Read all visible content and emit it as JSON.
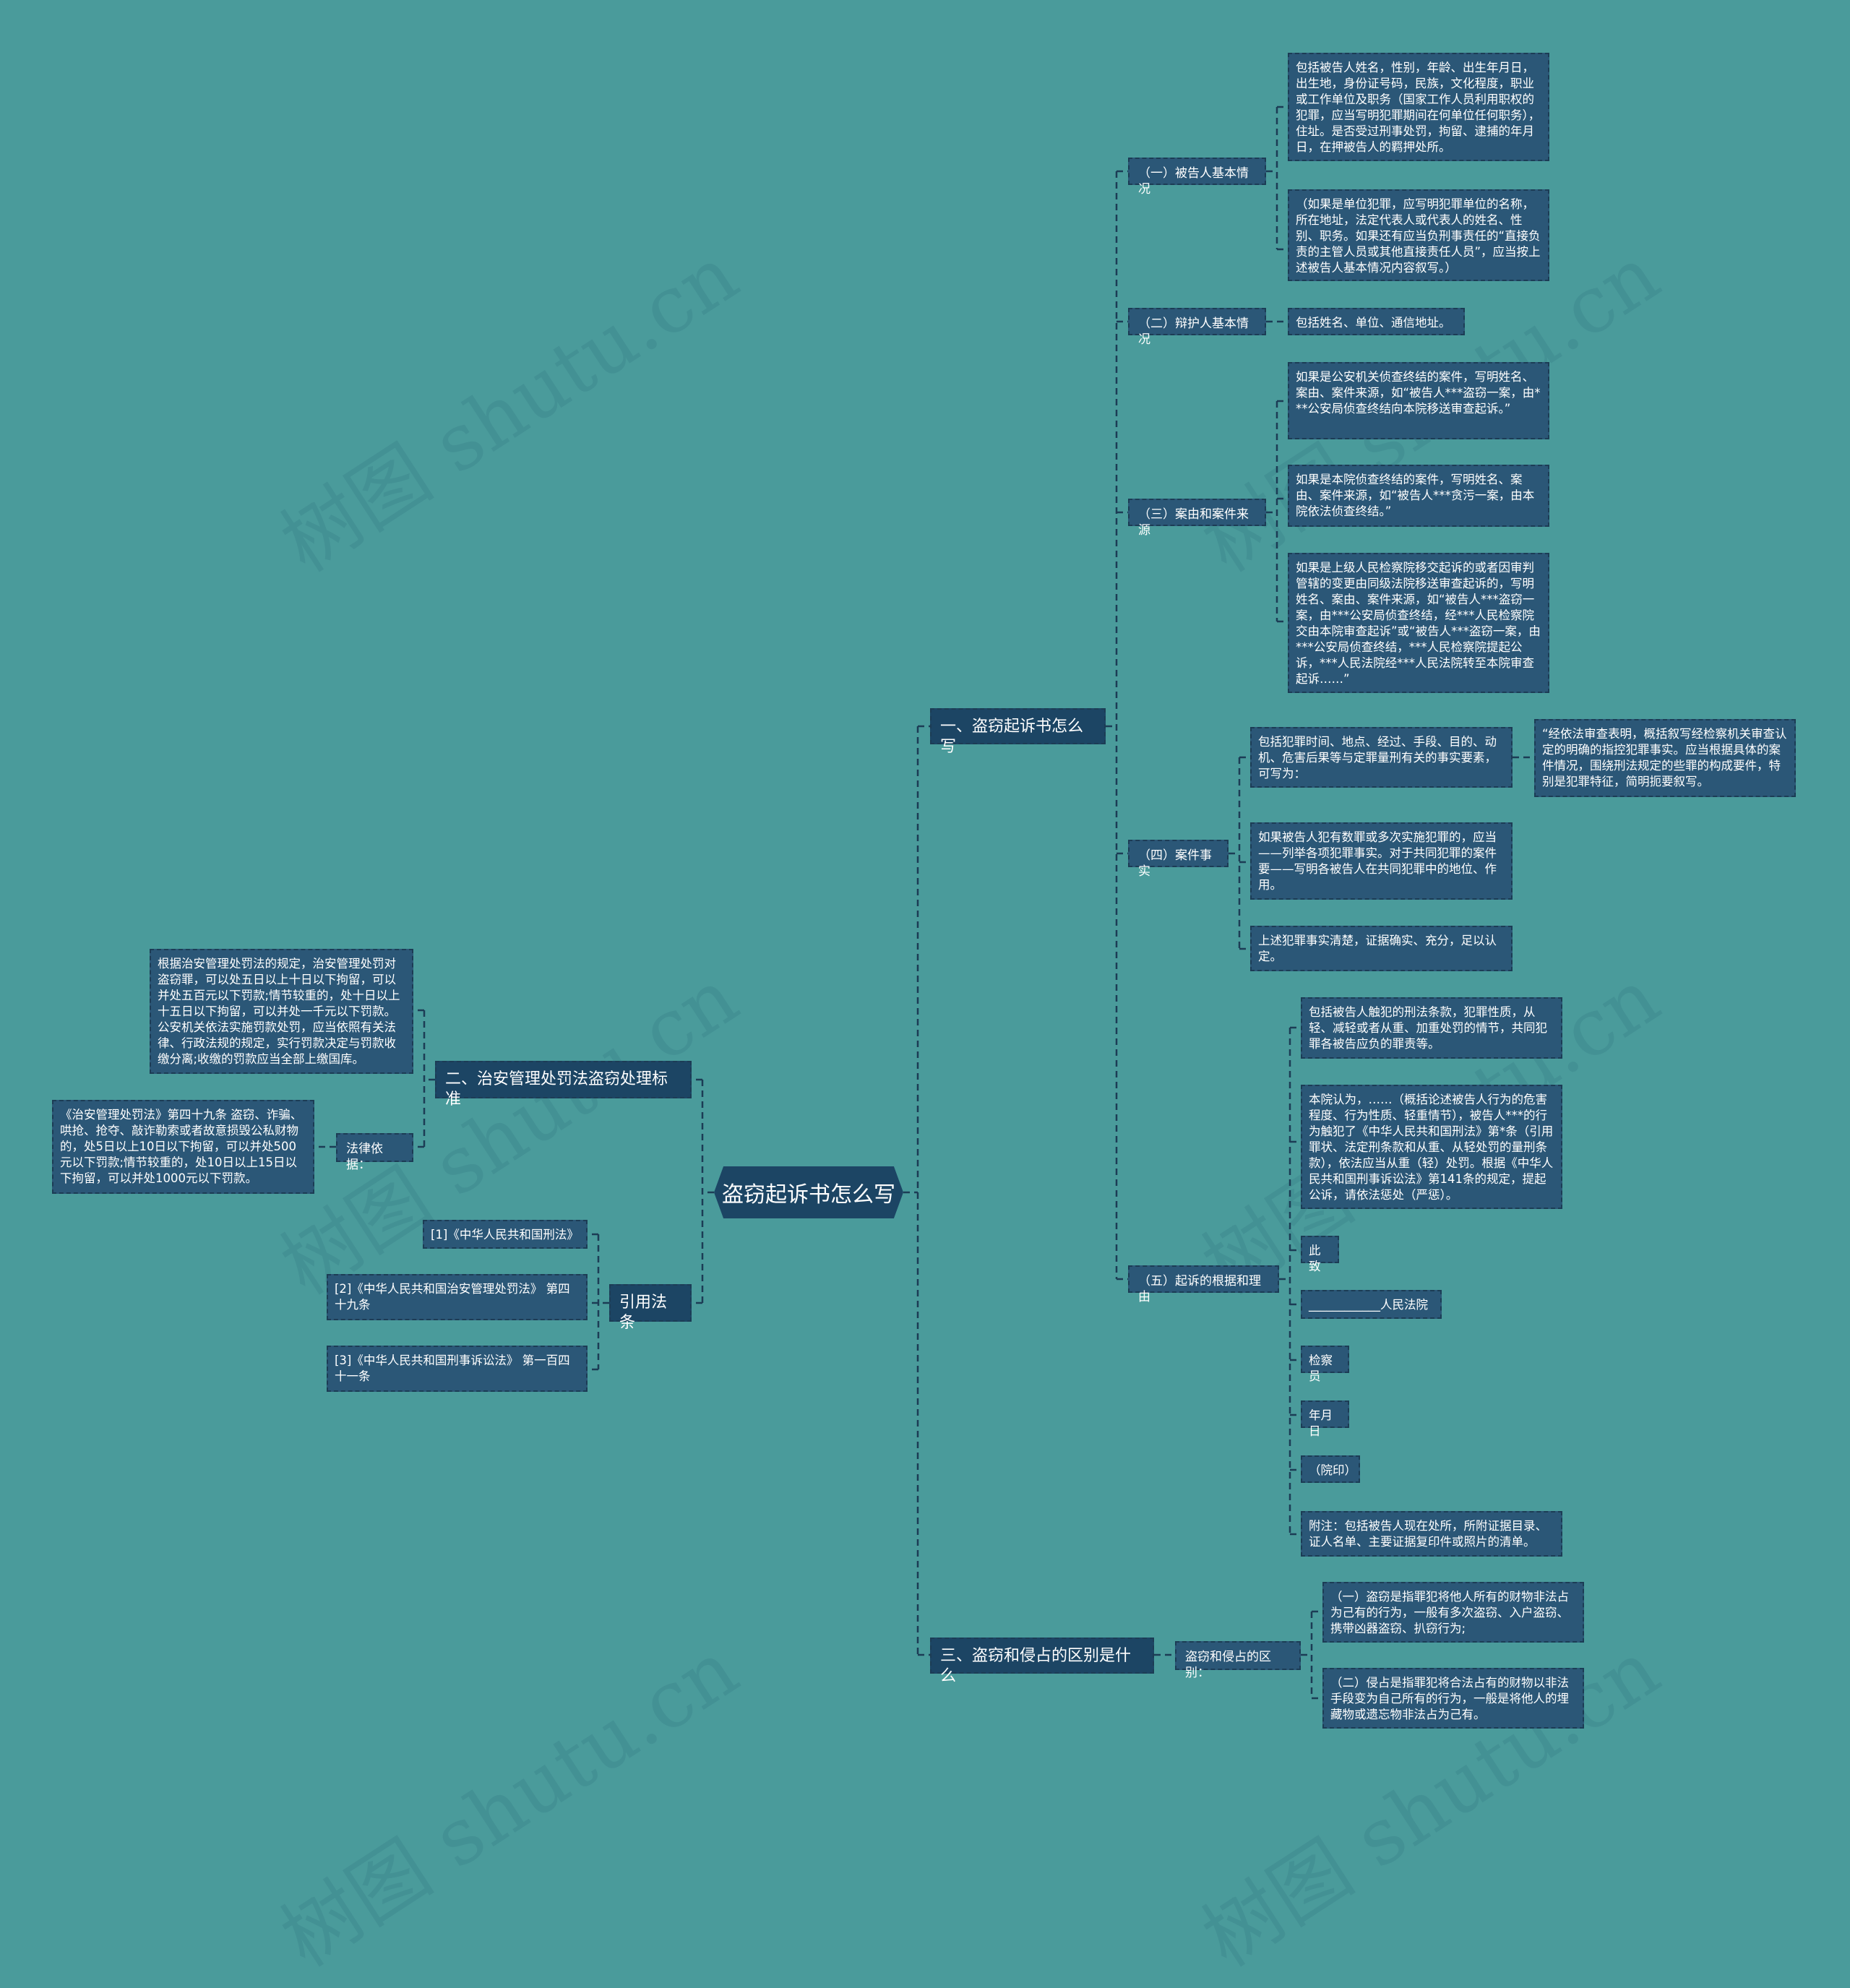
{
  "watermark": "树图 shutu.cn",
  "colors": {
    "background": "#4a9b9b",
    "node": "#2b5777",
    "branch": "#1c4564",
    "line": "#1c3c55"
  },
  "root": "盗窃起诉书怎么写",
  "branches": {
    "b1": {
      "label": "一、盗窃起诉书怎么写",
      "s1": {
        "label": "（一）被告人基本情况",
        "c1": "包括被告人姓名，性别，年龄、出生年月日，出生地，身份证号码，民族，文化程度，职业或工作单位及职务（国家工作人员利用职权的犯罪，应当写明犯罪期间在何单位任何职务），住址。是否受过刑事处罚，拘留、逮捕的年月日，在押被告人的羁押处所。",
        "c2": "（如果是单位犯罪，应写明犯罪单位的名称，所在地址，法定代表人或代表人的姓名、性别、职务。如果还有应当负刑事责任的“直接负责的主管人员或其他直接责任人员”，应当按上述被告人基本情况内容叙写。）"
      },
      "s2": {
        "label": "（二）辩护人基本情况",
        "c1": "包括姓名、单位、通信地址。"
      },
      "s3": {
        "label": "（三）案由和案件来源",
        "c1": "如果是公安机关侦查终结的案件，写明姓名、案由、案件来源，如“被告人***盗窃一案，由***公安局侦查终结向本院移送审查起诉。”",
        "c2": "如果是本院侦查终结的案件，写明姓名、案由、案件来源，如“被告人***贪污一案，由本院依法侦查终结。”",
        "c3": "如果是上级人民检察院移交起诉的或者因审判管辖的变更由同级法院移送审查起诉的，写明姓名、案由、案件来源，如“被告人***盗窃一案，由***公安局侦查终结，经***人民检察院交由本院审查起诉”或“被告人***盗窃一案，由***公安局侦查终结，***人民检察院提起公诉，***人民法院经***人民法院转至本院审查起诉……”"
      },
      "s4": {
        "label": "（四）案件事实",
        "c1": "包括犯罪时间、地点、经过、手段、目的、动机、危害后果等与定罪量刑有关的事实要素，可写为：",
        "c1a": "“经依法审查表明，概括叙写经检察机关审查认定的明确的指控犯罪事实。应当根据具体的案件情况，围绕刑法规定的些罪的构成要件，特别是犯罪特征，简明扼要叙写。",
        "c2": "如果被告人犯有数罪或多次实施犯罪的，应当——列举各项犯罪事实。对于共同犯罪的案件要——写明各被告人在共同犯罪中的地位、作用。",
        "c3": "上述犯罪事实清楚，证据确实、充分，足以认定。"
      },
      "s5": {
        "label": "（五）起诉的根据和理由",
        "c1": "包括被告人触犯的刑法条款，犯罪性质，从轻、减轻或者从重、加重处罚的情节，共同犯罪各被告应负的罪责等。",
        "c2": "本院认为，……（概括论述被告人行为的危害程度、行为性质、轻重情节），被告人***的行为触犯了《中华人民共和国刑法》第*条（引用罪状、法定刑条款和从重、从轻处罚的量刑条款），依法应当从重（轻）处罚。根据《中华人民共和国刑事诉讼法》第141条的规定，提起公诉，请依法惩处（严惩）。",
        "c3": "此致",
        "c4": "____________人民法院",
        "c5": "检察员",
        "c6": "年月日",
        "c7": "（院印）",
        "c8": "附注：包括被告人现在处所，所附证据目录、证人名单、主要证据复印件或照片的清单。"
      }
    },
    "b2": {
      "label": "二、治安管理处罚法盗窃处理标准",
      "c1": "根据治安管理处罚法的规定，治安管理处罚对盗窃罪，可以处五日以上十日以下拘留，可以并处五百元以下罚款;情节较重的，处十日以上十五日以下拘留，可以并处一千元以下罚款。公安机关依法实施罚款处罚，应当依照有关法律、行政法规的规定，实行罚款决定与罚款收缴分离;收缴的罚款应当全部上缴国库。",
      "s1": {
        "label": "法律依据：",
        "c1": "《治安管理处罚法》第四十九条 盗窃、诈骗、哄抢、抢夺、敲诈勒索或者故意损毁公私财物的，处5日以上10日以下拘留，可以并处500元以下罚款;情节较重的，处10日以上15日以下拘留，可以并处1000元以下罚款。"
      }
    },
    "b3": {
      "label": "引用法条",
      "c1": "[1]《中华人民共和国刑法》",
      "c2": "[2]《中华人民共和国治安管理处罚法》 第四十九条",
      "c3": "[3]《中华人民共和国刑事诉讼法》 第一百四十一条"
    },
    "b4": {
      "label": "三、盗窃和侵占的区别是什么",
      "s1": {
        "label": "盗窃和侵占的区别：",
        "c1": "（一）盗窃是指罪犯将他人所有的财物非法占为己有的行为，一般有多次盗窃、入户盗窃、携带凶器盗窃、扒窃行为;",
        "c2": "（二）侵占是指罪犯将合法占有的财物以非法手段变为自己所有的行为，一般是将他人的埋藏物或遗忘物非法占为己有。"
      }
    }
  }
}
